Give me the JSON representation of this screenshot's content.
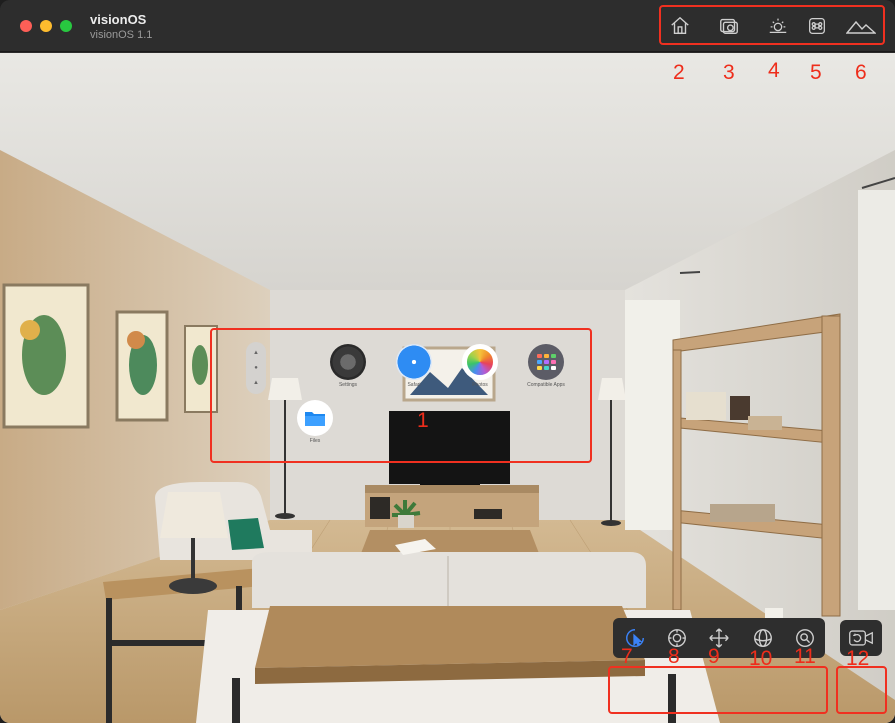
{
  "window": {
    "title": "visionOS",
    "subtitle": "visionOS 1.1"
  },
  "toolbar_icons": [
    "home-icon",
    "screenshot-camera-icon",
    "brightness-icon",
    "command-key-icon",
    "mountains-icon"
  ],
  "apps": [
    {
      "label": "Settings",
      "icon": "settings-icon"
    },
    {
      "label": "Safari",
      "icon": "safari-icon"
    },
    {
      "label": "Photos",
      "icon": "photos-icon"
    },
    {
      "label": "Compatible Apps",
      "icon": "compatible-apps-icon"
    },
    {
      "label": "Files",
      "icon": "files-icon"
    }
  ],
  "bottom_toolbar_icons": [
    "select-pointer-icon",
    "look-around-icon",
    "pan-move-icon",
    "orbit-icon",
    "zoom-icon",
    "reset-camera-icon"
  ],
  "annotations": {
    "n1": "1",
    "n2": "2",
    "n3": "3",
    "n4": "4",
    "n5": "5",
    "n6": "6",
    "n7": "7",
    "n8": "8",
    "n9": "9",
    "n10": "10",
    "n11": "11",
    "n12": "12"
  },
  "colors": {
    "annotation_red": "#f03020",
    "toolbar_bg": "#2d2d2d",
    "accent_blue": "#3b82f6"
  }
}
